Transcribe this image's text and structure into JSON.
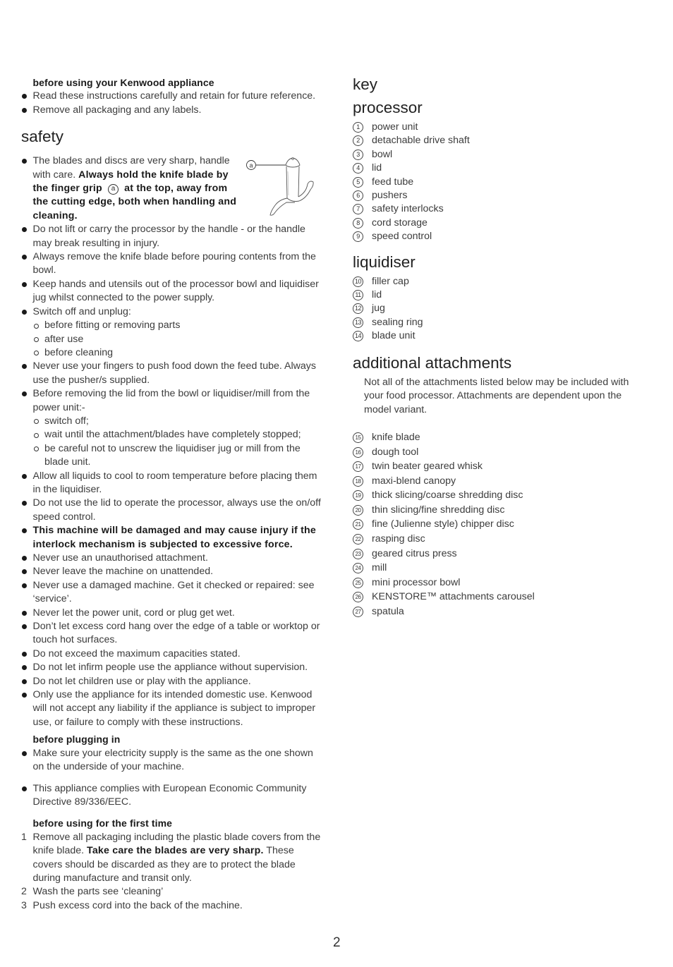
{
  "left": {
    "intro": {
      "heading": "before using your Kenwood appliance",
      "items": [
        "Read these instructions carefully and retain for future reference.",
        "Remove all packaging and any labels."
      ]
    },
    "safety": {
      "title": "safety",
      "first_item": {
        "normal": "The blades and discs are very sharp, handle with care. ",
        "bold_a": "Always hold the knife blade by the finger grip",
        "callout": "a",
        "bold_b": " at the top, away from the cutting edge, both when handling and cleaning."
      },
      "figure_label": "a",
      "items": [
        "Do not lift or carry the processor by the handle - or the handle may break resulting in injury.",
        "Always remove the knife blade before pouring contents from the bowl.",
        "Keep hands and utensils out of the processor bowl and liquidiser jug whilst connected to the power supply."
      ],
      "switch_off": {
        "text": "Switch off and unplug:",
        "sub": [
          "before fitting or removing parts",
          "after use",
          "before cleaning"
        ]
      },
      "feed_tube": "Never use your fingers to push food down the feed tube. Always use the pusher/s supplied.",
      "before_removing": {
        "text": "Before removing the lid from the bowl or liquidiser/mill from the power unit:-",
        "sub": [
          "switch off;",
          "wait until the attachment/blades have completely stopped;",
          "be careful not to unscrew the liquidiser jug or mill from the blade unit."
        ]
      },
      "items2": [
        "Allow all liquids to cool to room temperature before placing them in the liquidiser.",
        "Do not use the lid to operate the processor, always use the on/off speed control."
      ],
      "warning_bold": "This machine will be damaged and may cause injury if the interlock mechanism is subjected to excessive force.",
      "items3": [
        "Never use an unauthorised attachment.",
        "Never leave the machine on unattended.",
        "Never use a damaged machine. Get it checked or repaired: see ‘service’.",
        "Never let the power unit, cord or plug get wet.",
        "Don’t let excess cord hang over the edge of a table or worktop or touch hot surfaces.",
        "Do not exceed the maximum capacities stated.",
        "Do not let infirm people use the appliance without supervision.",
        "Do not let children use or play with the appliance.",
        "Only use the appliance for its intended domestic use. Kenwood will not accept any liability if the appliance is subject to improper use, or failure to comply with these instructions."
      ]
    },
    "plugging": {
      "heading": "before plugging in",
      "item1": "Make sure your electricity supply is the same as the one shown on the underside of your machine.",
      "item2": "This appliance complies with European Economic Community Directive 89/336/EEC."
    },
    "first_time": {
      "heading": "before using for the first time",
      "step1": {
        "num": "1",
        "normal_a": "Remove all packaging including the plastic blade covers from the knife blade. ",
        "bold": "Take care the blades are very sharp.",
        "normal_b": " These covers should be discarded as they are to protect the blade during manufacture and transit only."
      },
      "step2": {
        "num": "2",
        "text": "Wash the parts see ‘cleaning’"
      },
      "step3": {
        "num": "3",
        "text": "Push excess cord into the back of the machine."
      }
    }
  },
  "right": {
    "key_title": "key",
    "processor": {
      "title": "processor",
      "items": [
        {
          "n": "1",
          "label": "power unit"
        },
        {
          "n": "2",
          "label": "detachable drive shaft"
        },
        {
          "n": "3",
          "label": "bowl"
        },
        {
          "n": "4",
          "label": "lid"
        },
        {
          "n": "5",
          "label": "feed tube"
        },
        {
          "n": "6",
          "label": "pushers"
        },
        {
          "n": "7",
          "label": "safety interlocks"
        },
        {
          "n": "8",
          "label": "cord storage"
        },
        {
          "n": "9",
          "label": "speed control"
        }
      ]
    },
    "liquidiser": {
      "title": "liquidiser",
      "items": [
        {
          "n": "10",
          "label": "filler cap"
        },
        {
          "n": "11",
          "label": "lid"
        },
        {
          "n": "12",
          "label": "jug"
        },
        {
          "n": "13",
          "label": "sealing ring"
        },
        {
          "n": "14",
          "label": "blade unit"
        }
      ]
    },
    "attachments": {
      "title": "additional attachments",
      "note": "Not all of the attachments listed below may be included with your food processor. Attachments are dependent upon the model variant.",
      "items": [
        {
          "n": "15",
          "label": "knife blade"
        },
        {
          "n": "16",
          "label": "dough tool"
        },
        {
          "n": "17",
          "label": "twin beater geared whisk"
        },
        {
          "n": "18",
          "label": "maxi-blend canopy"
        },
        {
          "n": "19",
          "label": "thick slicing/coarse shredding disc"
        },
        {
          "n": "20",
          "label": "thin slicing/fine shredding disc"
        },
        {
          "n": "21",
          "label": "fine (Julienne style) chipper disc"
        },
        {
          "n": "22",
          "label": "rasping disc"
        },
        {
          "n": "23",
          "label": "geared citrus press"
        },
        {
          "n": "24",
          "label": "mill"
        },
        {
          "n": "25",
          "label": "mini processor bowl"
        },
        {
          "n": "26",
          "label": "KENSTORE™ attachments carousel"
        },
        {
          "n": "27",
          "label": "spatula"
        }
      ]
    }
  },
  "page_number": "2"
}
